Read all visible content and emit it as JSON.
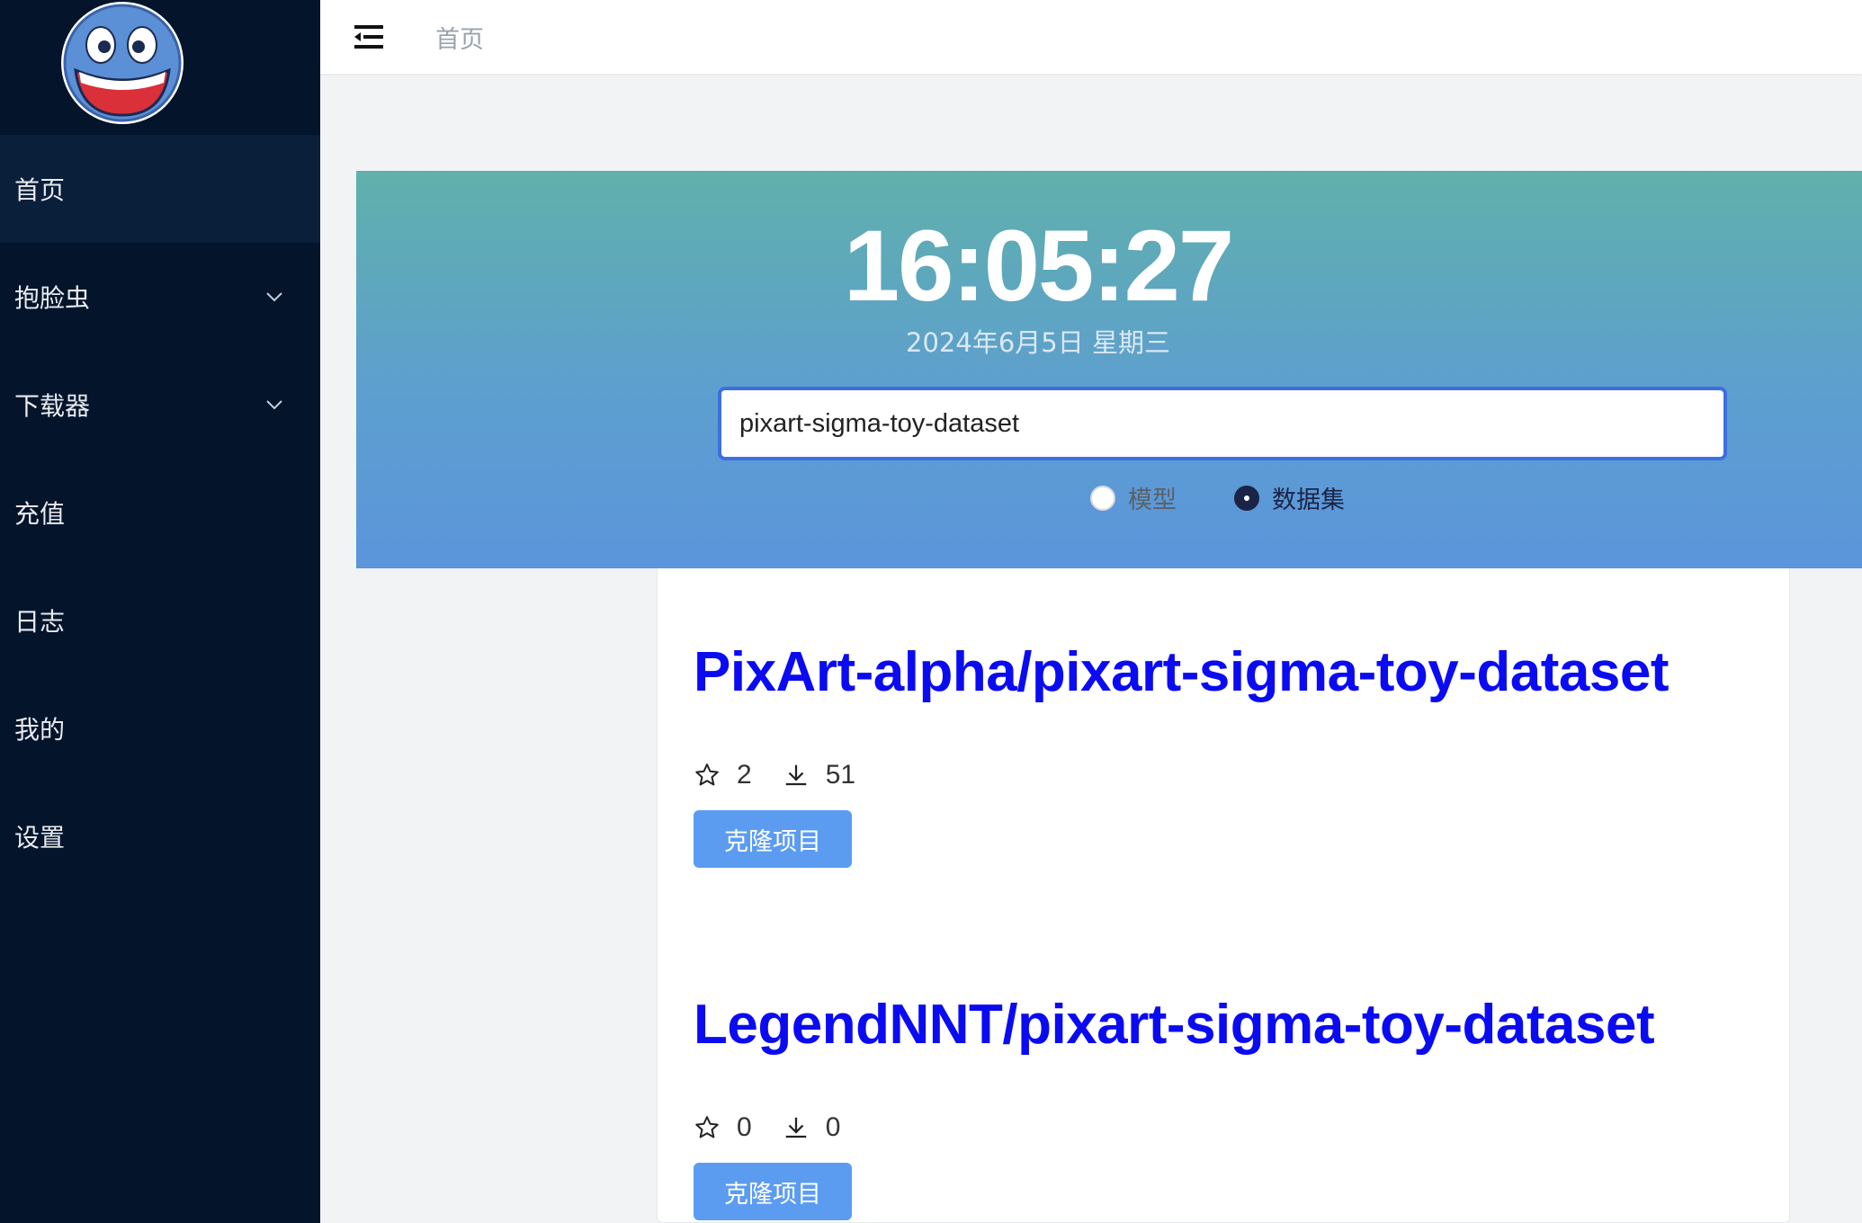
{
  "sidebar": {
    "items": [
      {
        "label": "首页",
        "active": true,
        "expandable": false
      },
      {
        "label": "抱脸虫",
        "active": false,
        "expandable": true
      },
      {
        "label": "下载器",
        "active": false,
        "expandable": true
      },
      {
        "label": "充值",
        "active": false,
        "expandable": false
      },
      {
        "label": "日志",
        "active": false,
        "expandable": false
      },
      {
        "label": "我的",
        "active": false,
        "expandable": false
      },
      {
        "label": "设置",
        "active": false,
        "expandable": false
      }
    ]
  },
  "topbar": {
    "breadcrumb": "首页",
    "menu_icon": "menu-fold-icon"
  },
  "banner": {
    "time": "16:05:27",
    "date": "2024年6月5日 星期三",
    "search_value": "pixart-sigma-toy-dataset",
    "radio_options": [
      "模型",
      "数据集"
    ],
    "selected_option": "数据集"
  },
  "results": [
    {
      "title": "PixArt-alpha/pixart-sigma-toy-dataset",
      "likes": "2",
      "downloads": "51",
      "button_label": "克隆项目"
    },
    {
      "title": "LegendNNT/pixart-sigma-toy-dataset",
      "likes": "0",
      "downloads": "0",
      "button_label": "克隆项目"
    }
  ],
  "colors": {
    "sidebar_bg": "#03142b",
    "link": "#0b0bf2",
    "button": "#5b9cf1",
    "search_border": "#3d6fe0"
  }
}
